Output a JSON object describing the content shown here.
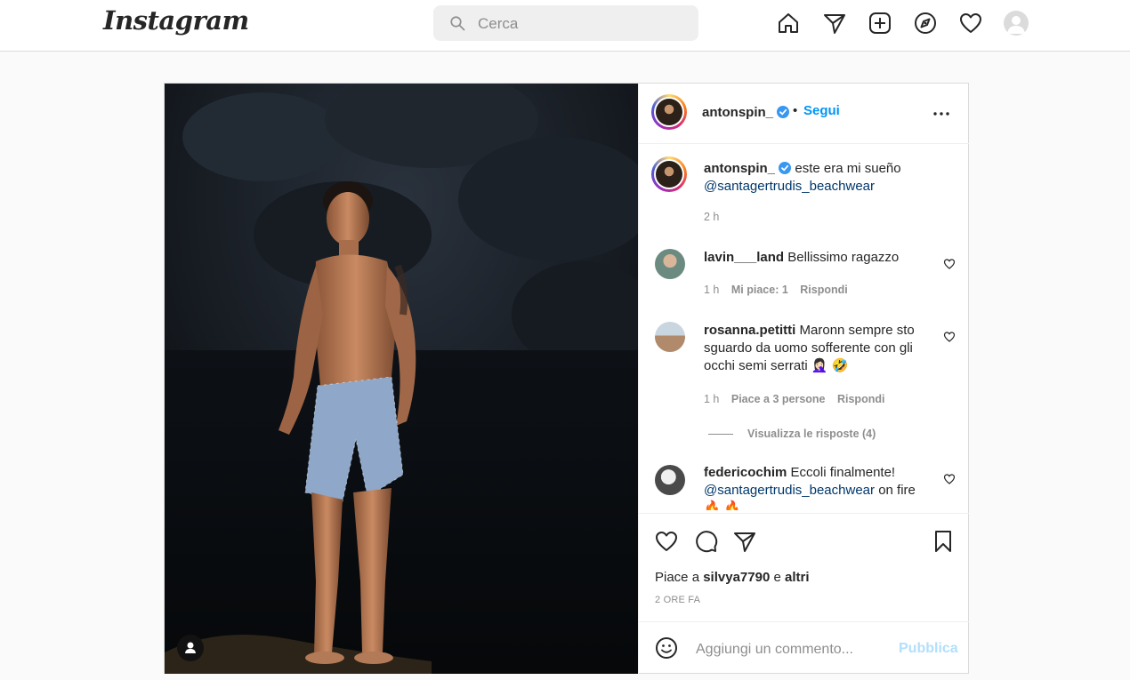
{
  "topbar": {
    "logo": "Instagram",
    "search_placeholder": "Cerca",
    "icons": [
      "home-icon",
      "direct-icon",
      "new-post-icon",
      "explore-icon",
      "activity-icon",
      "profile-avatar"
    ]
  },
  "post": {
    "author": "antonspin_",
    "follow_label": "Segui",
    "separator": "•",
    "caption_text": "este era mi sueño",
    "caption_mention": "@santagertrudis_beachwear",
    "caption_time": "2 h",
    "comments": [
      {
        "user": "lavin___land",
        "text": "Bellissimo ragazzo",
        "time": "1 h",
        "likes": "Mi piace: 1",
        "reply": "Rispondi"
      },
      {
        "user": "rosanna.petitti",
        "text": "Maronn sempre sto sguardo da uomo sofferente con gli occhi semi serrati 🤦🏻‍♀️ 🤣",
        "time": "1 h",
        "likes": "Piace a 3 persone",
        "reply": "Rispondi",
        "view_replies": "Visualizza le risposte (4)"
      },
      {
        "user": "federicochim",
        "text": "Eccoli finalmente!",
        "mention": "@santagertrudis_beachwear",
        "after": "on fire",
        "emoji": "🔥 🔥"
      }
    ],
    "likes_prefix": "Piace a",
    "likes_user": "silvya7790",
    "likes_mid": "e",
    "likes_rest": "altri",
    "posted": "2 ORE FA",
    "comment_placeholder": "Aggiungi un commento...",
    "publish_label": "Pubblica"
  },
  "colors": {
    "accent": "#0095f6",
    "publish_disabled": "#b2dffc",
    "link": "#00376b",
    "muted": "#8e8e8e",
    "verified": "#3897f0"
  }
}
